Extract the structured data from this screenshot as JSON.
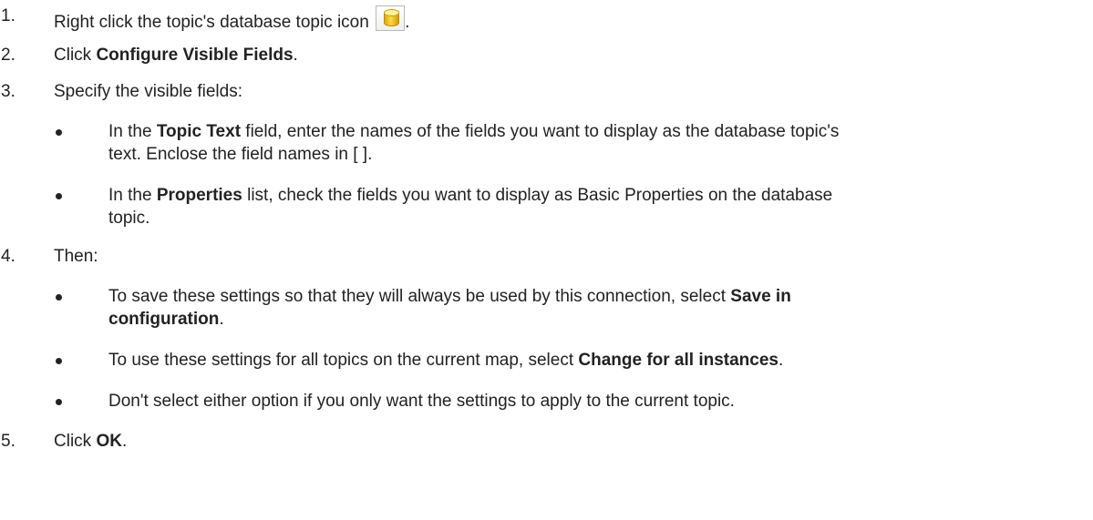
{
  "steps": [
    {
      "num": "1.",
      "before": "Right click the topic's database topic icon",
      "after": "."
    },
    {
      "num": "2.",
      "before": "Click ",
      "bold": "Configure Visible Fields",
      "after": "."
    },
    {
      "num": "3.",
      "text": "Specify the visible fields:",
      "bullets": [
        {
          "before": "In the ",
          "bold": "Topic Text",
          "after": " field, enter the names of the fields you want to display as the database topic's",
          "line2": "text. Enclose the field names in [ ]."
        },
        {
          "before": "In the ",
          "bold": "Properties",
          "after": " list, check the fields you want to display as Basic Properties on the database",
          "line2": "topic."
        }
      ]
    },
    {
      "num": "4.",
      "text": "Then:",
      "bullets": [
        {
          "before": "To save these settings so that they will always be used by this connection, select ",
          "bold": "Save in",
          "bold2": "configuration",
          "after2": "."
        },
        {
          "before": "To use these settings for all topics on the current map, select ",
          "bold": "Change for all instances",
          "after": "."
        },
        {
          "text": "Don't select either option if you only want the settings to apply to the current topic."
        }
      ]
    },
    {
      "num": "5.",
      "before": "Click ",
      "bold": "OK",
      "after": "."
    }
  ],
  "icons": {
    "database_topic": "database-cylinder-icon",
    "database_color": "#f0b800"
  }
}
